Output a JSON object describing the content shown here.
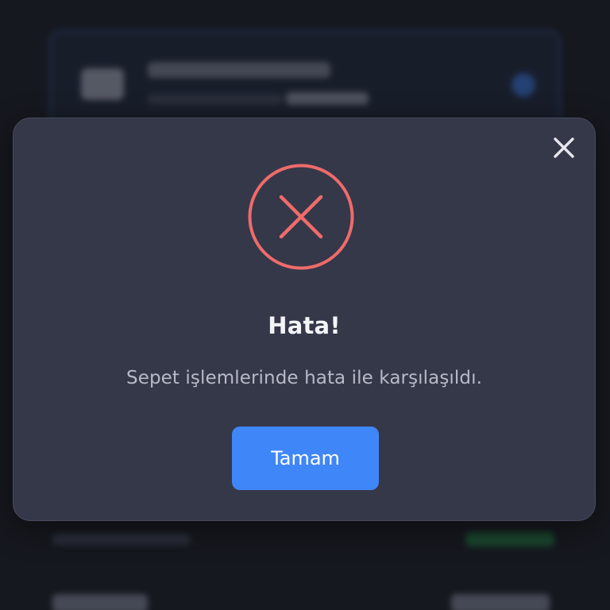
{
  "dialog": {
    "title": "Hata!",
    "message": "Sepet işlemlerinde hata ile karşılaşıldı.",
    "confirm_label": "Tamam",
    "icon": "error-x-circle-icon",
    "close_icon": "close-icon"
  },
  "colors": {
    "error": "#ef6b6b",
    "primary": "#3f86f8",
    "dialog_background": "#353849",
    "page_background": "#16181f"
  }
}
